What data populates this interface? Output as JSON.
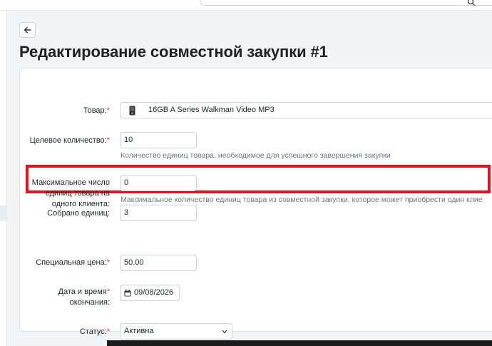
{
  "page": {
    "title": "Редактирование совместной закупки #1"
  },
  "form": {
    "product": {
      "label": "Товар:",
      "value": "16GB A Series Walkman Video MP3"
    },
    "target_quantity": {
      "label": "Целевое количество:",
      "value": "10",
      "help": "Количество единиц товара, необходимое для успешного завершения закупки"
    },
    "max_per_client": {
      "label_lines": [
        "Максимальное число",
        "единиц товара на",
        "одного клиента:"
      ],
      "value": "0",
      "help": "Максимальное количество единиц товара из совместной закупки, которое может приобрести один клие"
    },
    "collected_units": {
      "label": "Собрано единиц:",
      "value": "3"
    },
    "special_price": {
      "label": "Специальная цена:",
      "value": "50.00"
    },
    "end_datetime": {
      "label_lines": [
        "Дата и время",
        "окончания:"
      ],
      "value": "09/08/2026"
    },
    "status": {
      "label": "Статус:",
      "value": "Активна"
    },
    "required_mark": "*"
  },
  "icons": {
    "back": "arrow-left-icon",
    "product": "mp3-player-icon",
    "calendar": "calendar-icon",
    "select": "chevron-down-icon",
    "search": "search-icon"
  },
  "colors": {
    "highlight": "#e8101a",
    "required": "#d9363e",
    "help_text": "#6c757d"
  }
}
